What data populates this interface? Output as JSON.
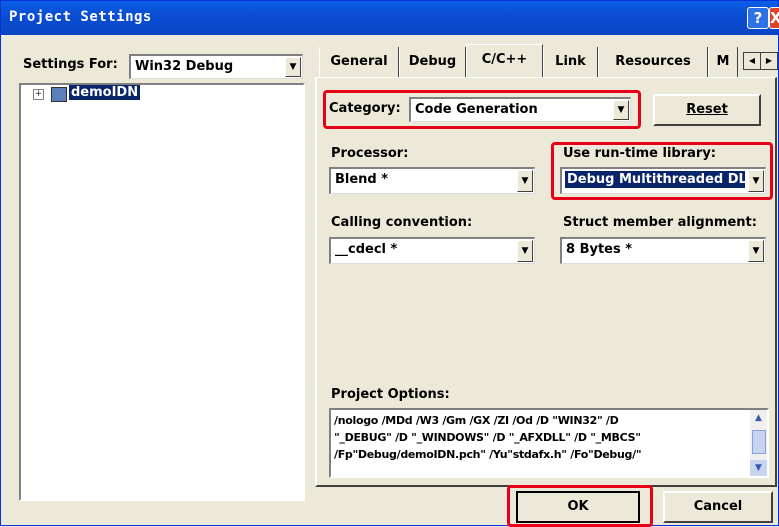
{
  "window": {
    "title": "Project Settings",
    "help_label": "?",
    "close_label": "X"
  },
  "settings_for": {
    "label": "Settings For:",
    "value": "Win32 Debug"
  },
  "tree": {
    "expander": "+",
    "project_name": "demoIDN"
  },
  "tabs": [
    {
      "label": "General"
    },
    {
      "label": "Debug"
    },
    {
      "label": "C/C++"
    },
    {
      "label": "Link"
    },
    {
      "label": "Resources"
    },
    {
      "label": "M"
    }
  ],
  "category": {
    "label": "Category:",
    "value": "Code Generation"
  },
  "reset_label": "Reset",
  "processor": {
    "label": "Processor:",
    "value": "Blend *"
  },
  "runtime_library": {
    "label": "Use run-time library:",
    "value": "Debug Multithreaded DL"
  },
  "calling_convention": {
    "label": "Calling convention:",
    "value": "__cdecl *"
  },
  "struct_alignment": {
    "label": "Struct member alignment:",
    "value": "8 Bytes *"
  },
  "project_options": {
    "label": "Project Options:",
    "lines": [
      "/nologo /MDd /W3 /Gm /GX /ZI /Od /D \"WIN32\" /D",
      "\"_DEBUG\" /D \"_WINDOWS\" /D \"_AFXDLL\" /D \"_MBCS\"",
      "/Fp\"Debug/demoIDN.pch\" /Yu\"stdafx.h\" /Fo\"Debug/\""
    ]
  },
  "buttons": {
    "ok": "OK",
    "cancel": "Cancel"
  },
  "colors": {
    "highlight_outline": "#e8001a",
    "selection": "#0a246a",
    "title_bar": "#0b4ed3"
  }
}
